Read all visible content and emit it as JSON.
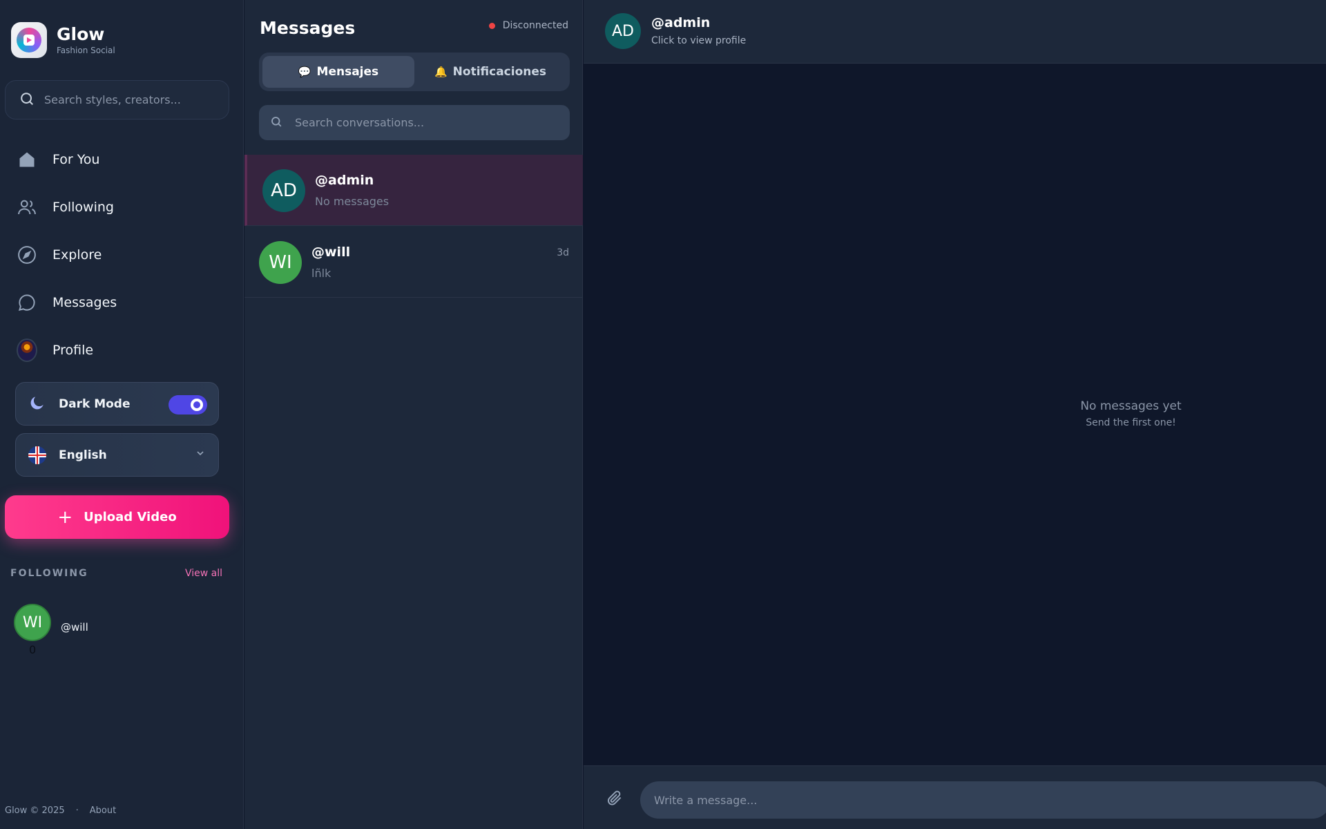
{
  "brand": {
    "name": "Glow",
    "tagline": "Fashion Social"
  },
  "sidebar": {
    "search_placeholder": "Search styles, creators...",
    "nav": [
      {
        "label": "For You",
        "icon": "home-icon"
      },
      {
        "label": "Following",
        "icon": "users-icon"
      },
      {
        "label": "Explore",
        "icon": "compass-icon"
      },
      {
        "label": "Messages",
        "icon": "chat-icon"
      },
      {
        "label": "Profile",
        "icon": "avatar"
      }
    ],
    "dark_mode": {
      "label": "Dark Mode",
      "enabled": true
    },
    "language": {
      "label": "English",
      "icon": "uk-flag-icon"
    },
    "upload": {
      "label": "Upload Video",
      "icon": "plus-icon"
    },
    "following_section": {
      "title": "FOLLOWING",
      "view_all": "View all",
      "users": [
        {
          "initials": "WI",
          "handle": "@will",
          "count": "0"
        }
      ]
    },
    "footer": {
      "copyright": "Glow © 2025",
      "separator": "·",
      "about": "About"
    }
  },
  "conversations": {
    "title": "Messages",
    "status": "Disconnected",
    "tabs": [
      {
        "label": "Mensajes",
        "icon": "💬",
        "active": true
      },
      {
        "label": "Notificaciones",
        "icon": "🔔",
        "active": false
      }
    ],
    "search_placeholder": "Search conversations...",
    "items": [
      {
        "initials": "AD",
        "handle": "@admin",
        "preview": "No messages",
        "time": ""
      },
      {
        "initials": "WI",
        "handle": "@will",
        "preview": "lñlk",
        "time": "3d"
      }
    ]
  },
  "chat": {
    "initials": "AD",
    "handle": "@admin",
    "subtitle": "Click to view profile",
    "empty_title": "No messages yet",
    "empty_subtitle": "Send the first one!",
    "composer_placeholder": "Write a message..."
  },
  "colors": {
    "accent": "#ec4899",
    "toggle": "#4f46e5",
    "status_disconnected": "#ef4444",
    "avatar_admin": "#0f5c5f",
    "avatar_will": "#3fa34d"
  }
}
